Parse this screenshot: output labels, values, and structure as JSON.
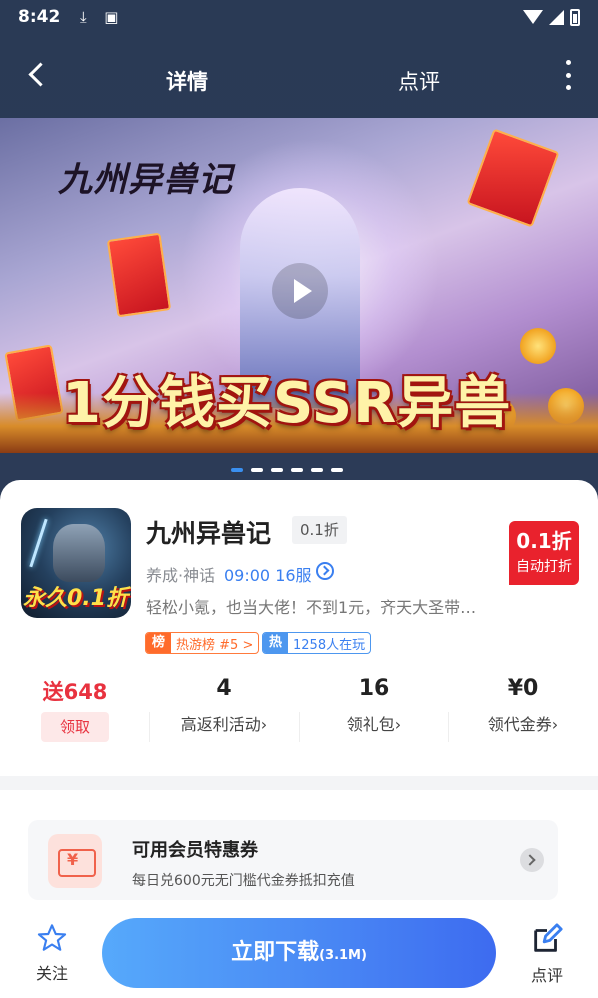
{
  "status_bar": {
    "time": "8:42"
  },
  "nav": {
    "tab_detail": "详情",
    "tab_review": "点评"
  },
  "banner": {
    "logo_text": "九州异兽记",
    "promo_text": "1分钱买SSR异兽",
    "slide_count": 6,
    "active_slide": 1
  },
  "game": {
    "title": "九州异兽记",
    "discount_chip": "0.1折",
    "genre": "养成·神话",
    "server": "09:00 16服",
    "description": "轻松小氪，也当大佬！不到1元，齐天大圣带…",
    "icon_tag": "永久0.1折",
    "badge_main": "0.1折",
    "badge_sub": "自动打折",
    "rank_label": "榜",
    "rank_text": "热游榜 #5 >",
    "hot_label": "热",
    "hot_text": "1258人在玩"
  },
  "stats": [
    {
      "value": "送648",
      "label": "领取"
    },
    {
      "value": "4",
      "label": "高返利活动›"
    },
    {
      "value": "16",
      "label": "领礼包›"
    },
    {
      "value": "¥0",
      "label": "领代金券›"
    }
  ],
  "member": {
    "title": "可用会员特惠券",
    "subtitle": "每日兑600元无门槛代金券抵扣充值",
    "icon_glyph": "¥"
  },
  "bottom": {
    "follow_label": "关注",
    "download_label": "立即下载",
    "download_size": "(3.1M)",
    "review_label": "点评"
  },
  "colors": {
    "accent_blue": "#3a7ff0",
    "accent_red": "#e8323f",
    "header_bg": "#2c3b57"
  }
}
